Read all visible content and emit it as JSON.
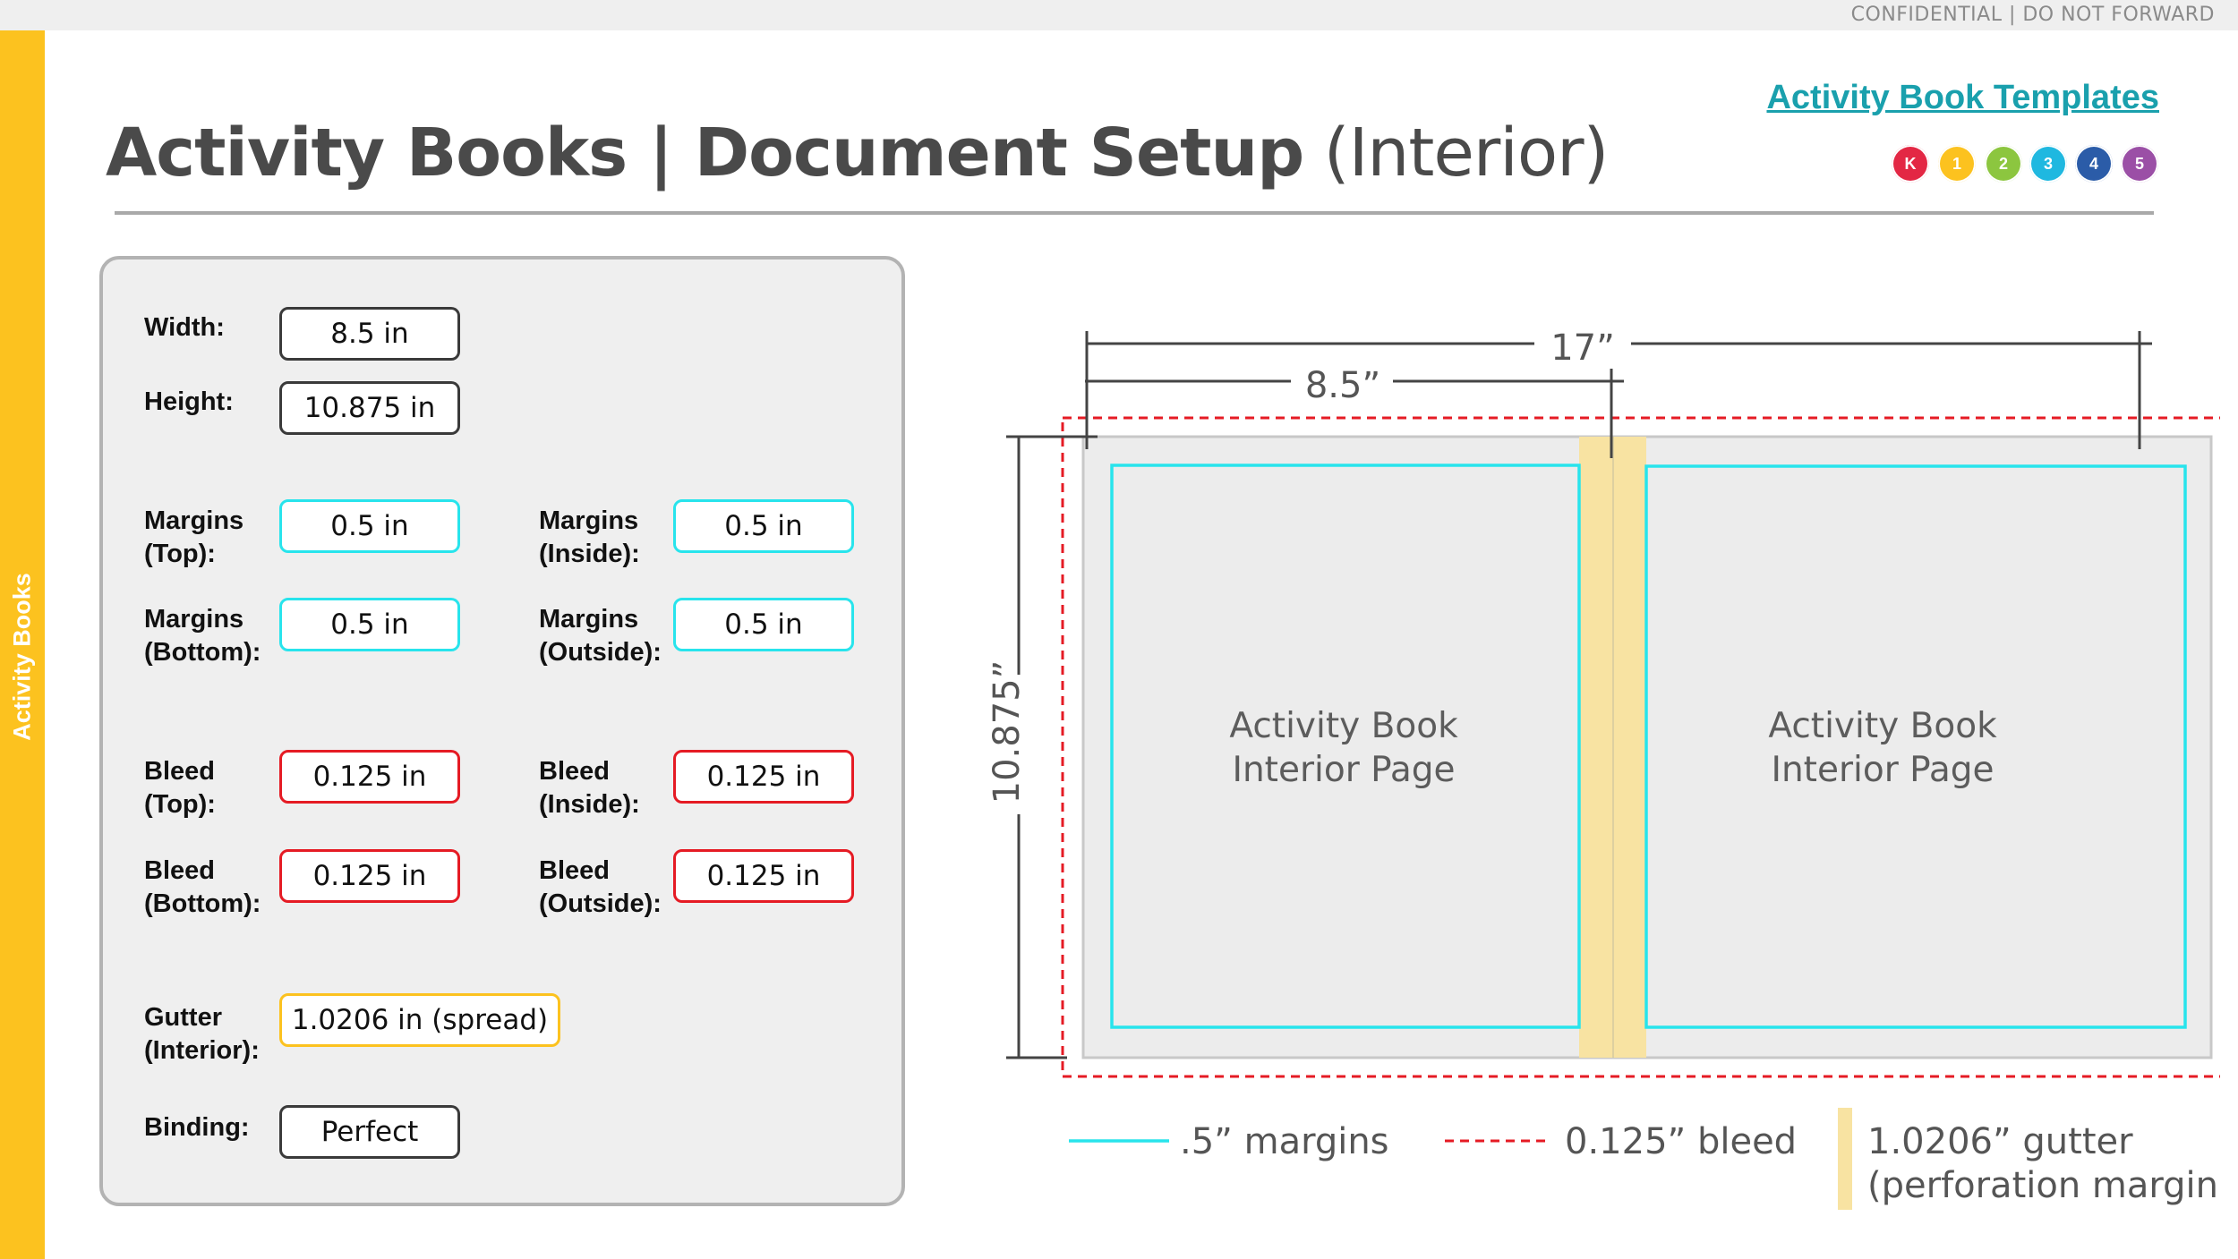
{
  "header": {
    "confidential": "CONFIDENTIAL | DO NOT FORWARD",
    "title_main": "Activity Books | Document Setup",
    "title_sub": "(Interior)",
    "template_link": "Activity Book Templates"
  },
  "sidebar": {
    "label": "Activity Books"
  },
  "grades": [
    {
      "label": "K",
      "color": "#e32744"
    },
    {
      "label": "1",
      "color": "#fcc21f"
    },
    {
      "label": "2",
      "color": "#8cc63f"
    },
    {
      "label": "3",
      "color": "#1fb8e0"
    },
    {
      "label": "4",
      "color": "#2b5ca8"
    },
    {
      "label": "5",
      "color": "#9b4fa6"
    }
  ],
  "settings": {
    "width": {
      "label": "Width:",
      "value": "8.5 in"
    },
    "height": {
      "label": "Height:",
      "value": "10.875 in"
    },
    "margins_top": {
      "label1": "Margins",
      "label2": "(Top):",
      "value": "0.5 in"
    },
    "margins_inside": {
      "label1": "Margins",
      "label2": "(Inside):",
      "value": "0.5 in"
    },
    "margins_bottom": {
      "label1": "Margins",
      "label2": "(Bottom):",
      "value": "0.5 in"
    },
    "margins_outside": {
      "label1": "Margins",
      "label2": "(Outside):",
      "value": "0.5 in"
    },
    "bleed_top": {
      "label1": "Bleed",
      "label2": "(Top):",
      "value": "0.125 in"
    },
    "bleed_inside": {
      "label1": "Bleed",
      "label2": "(Inside):",
      "value": "0.125 in"
    },
    "bleed_bottom": {
      "label1": "Bleed",
      "label2": "(Bottom):",
      "value": "0.125 in"
    },
    "bleed_outside": {
      "label1": "Bleed",
      "label2": "(Outside):",
      "value": "0.125 in"
    },
    "gutter": {
      "label1": "Gutter",
      "label2": "(Interior):",
      "value": "1.0206 in (spread)"
    },
    "binding": {
      "label": "Binding:",
      "value": "Perfect"
    }
  },
  "diagram": {
    "spread_width": "17”",
    "page_width": "8.5”",
    "page_height": "10.875”",
    "left_page_line1": "Activity Book",
    "left_page_line2": "Interior Page",
    "right_page_line1": "Activity Book",
    "right_page_line2": "Interior Page"
  },
  "legend": {
    "margins": ".5” margins",
    "bleed": "0.125” bleed",
    "gutter_line1": "1.0206” gutter",
    "gutter_line2": "(perforation margin)"
  },
  "colors": {
    "sidebar": "#fcc21f",
    "margin": "#28e4ec",
    "bleed": "#e51b24",
    "gutter": "#f8e3a2",
    "link": "#1aa0ad"
  }
}
